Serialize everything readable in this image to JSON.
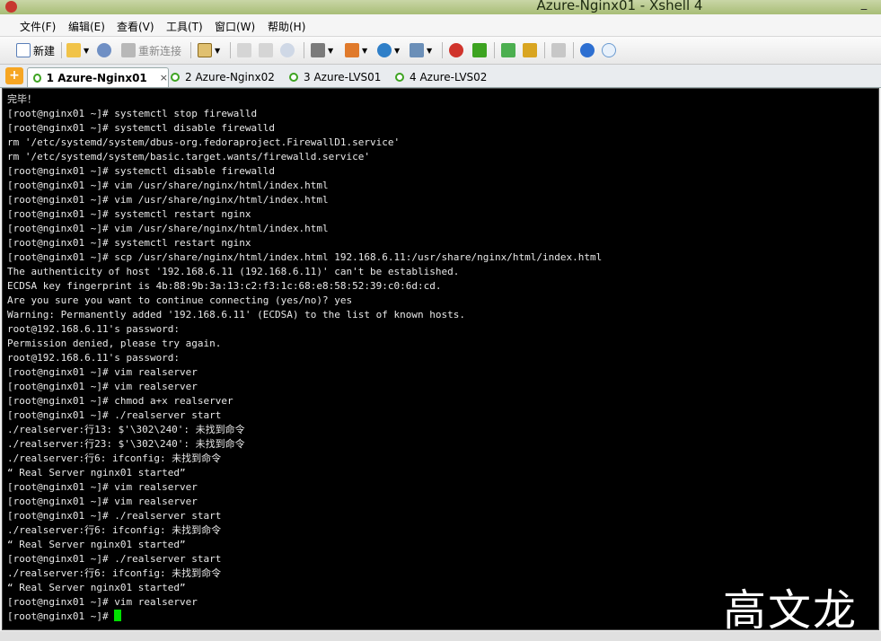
{
  "window": {
    "title": "Azure-Nginx01 - Xshell 4"
  },
  "menu": [
    {
      "label": "文件(F)"
    },
    {
      "label": "编辑(E)"
    },
    {
      "label": "查看(V)"
    },
    {
      "label": "工具(T)"
    },
    {
      "label": "窗口(W)"
    },
    {
      "label": "帮助(H)"
    }
  ],
  "toolbar": {
    "new_label": "新建",
    "reconnect_label": "重新连接"
  },
  "tabs": [
    {
      "label": "1 Azure-Nginx01",
      "active": true
    },
    {
      "label": "2 Azure-Nginx02",
      "active": false
    },
    {
      "label": "3 Azure-LVS01",
      "active": false
    },
    {
      "label": "4 Azure-LVS02",
      "active": false
    }
  ],
  "terminal": {
    "lines": [
      "完毕！",
      "[root@nginx01 ~]# systemctl stop firewalld",
      "[root@nginx01 ~]# systemctl disable firewalld",
      "rm '/etc/systemd/system/dbus-org.fedoraproject.FirewallD1.service'",
      "rm '/etc/systemd/system/basic.target.wants/firewalld.service'",
      "[root@nginx01 ~]# systemctl disable firewalld",
      "[root@nginx01 ~]# vim /usr/share/nginx/html/index.html",
      "[root@nginx01 ~]# vim /usr/share/nginx/html/index.html",
      "[root@nginx01 ~]# systemctl restart nginx",
      "[root@nginx01 ~]# vim /usr/share/nginx/html/index.html",
      "[root@nginx01 ~]# systemctl restart nginx",
      "[root@nginx01 ~]# scp /usr/share/nginx/html/index.html 192.168.6.11:/usr/share/nginx/html/index.html",
      "The authenticity of host '192.168.6.11 (192.168.6.11)' can't be established.",
      "ECDSA key fingerprint is 4b:88:9b:3a:13:c2:f3:1c:68:e8:58:52:39:c0:6d:cd.",
      "Are you sure you want to continue connecting (yes/no)? yes",
      "Warning: Permanently added '192.168.6.11' (ECDSA) to the list of known hosts.",
      "root@192.168.6.11's password:",
      "Permission denied, please try again.",
      "root@192.168.6.11's password:",
      "[root@nginx01 ~]# vim realserver",
      "[root@nginx01 ~]# vim realserver",
      "[root@nginx01 ~]# chmod a+x realserver",
      "[root@nginx01 ~]# ./realserver start",
      "./realserver:行13: $'\\302\\240': 未找到命令",
      "./realserver:行23: $'\\302\\240': 未找到命令",
      "./realserver:行6: ifconfig: 未找到命令",
      "“ Real Server nginx01 started”",
      "[root@nginx01 ~]# vim realserver",
      "[root@nginx01 ~]# vim realserver",
      "[root@nginx01 ~]# ./realserver start",
      "./realserver:行6: ifconfig: 未找到命令",
      "“ Real Server nginx01 started”",
      "[root@nginx01 ~]# ./realserver start",
      "./realserver:行6: ifconfig: 未找到命令",
      "“ Real Server nginx01 started”",
      "[root@nginx01 ~]# vim realserver"
    ],
    "prompt": "[root@nginx01 ~]# "
  },
  "watermark": "高文龙",
  "colors": {
    "terminal_bg": "#000000",
    "terminal_fg": "#e8e8e8",
    "cursor": "#00e000",
    "tab_dot": "#3da321"
  }
}
